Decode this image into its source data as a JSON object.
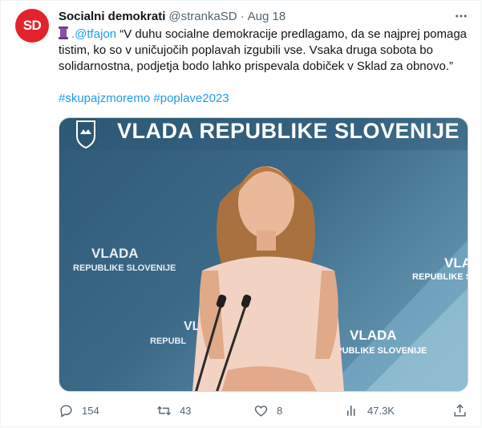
{
  "tweet": {
    "avatar_text": "SD",
    "author_name": "Socialni demokrati",
    "author_handle": "@strankaSD",
    "separator": "·",
    "date": "Aug 18",
    "mention": ".@tfajon",
    "body": " “V duhu socialne demokracije predlagamo, da se najprej pomaga tistim, ko so v uničujočih poplavah izgubili vse. Vsaka druga sobota bo solidarnostna, podjetja bodo lahko prispevala dobiček v Sklad za obnovo.”",
    "hashtags": "#skupajzmoremo #poplave2023"
  },
  "media": {
    "banner_text": "VLADA REPUBLIKE SLOVENIJE",
    "backdrop_left_line1": "VLADA",
    "backdrop_left_line2": "REPUBLIKE SLOVENIJE",
    "backdrop_right_line1": "VLADA",
    "backdrop_right_line2": "REPUBLIKE SLOVENIJE",
    "backdrop_center_line1": "VLADA",
    "backdrop_center_line2": "REPUBLIKE SLOVENIJE",
    "backdrop_lowleft_line1": "VL",
    "backdrop_lowleft_line2": "REPUBL"
  },
  "actions": {
    "replies": "154",
    "retweets": "43",
    "likes": "8",
    "views": "47.3K"
  },
  "colors": {
    "brand_red": "#e3232c",
    "link_blue": "#1d9bf0",
    "muted_gray": "#536471"
  }
}
